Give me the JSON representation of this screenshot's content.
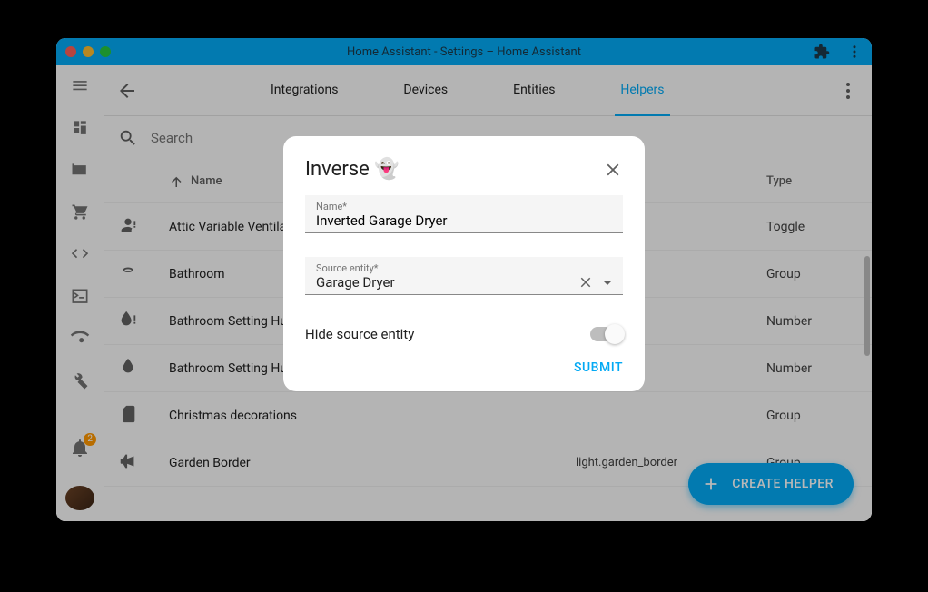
{
  "window": {
    "title": "Home Assistant - Settings – Home Assistant"
  },
  "tabs": [
    "Integrations",
    "Devices",
    "Entities",
    "Helpers"
  ],
  "activeTab": 3,
  "search": {
    "placeholder": "Search"
  },
  "tableHeaders": {
    "name": "Name",
    "type": "Type"
  },
  "rows": [
    {
      "icon": "person-alert",
      "name": "Attic Variable Ventilation",
      "entity": "",
      "type": "Toggle"
    },
    {
      "icon": "ring",
      "name": "Bathroom",
      "entity": "",
      "type": "Group"
    },
    {
      "icon": "water-alert",
      "name": "Bathroom Setting Humidity",
      "entity": "",
      "type": "Number"
    },
    {
      "icon": "water",
      "name": "Bathroom Setting Humidity",
      "entity": "",
      "type": "Number"
    },
    {
      "icon": "sdcard",
      "name": "Christmas decorations",
      "entity": "",
      "type": "Group"
    },
    {
      "icon": "bullhorn",
      "name": "Garden Border",
      "entity": "light.garden_border",
      "type": "Group"
    }
  ],
  "fab": {
    "label": "CREATE HELPER"
  },
  "notificationCount": "2",
  "dialog": {
    "title": "Inverse 👻",
    "nameLabel": "Name*",
    "nameValue": "Inverted Garage Dryer",
    "sourceLabel": "Source entity*",
    "sourceValue": "Garage Dryer",
    "hideLabel": "Hide source entity",
    "submit": "SUBMIT"
  }
}
